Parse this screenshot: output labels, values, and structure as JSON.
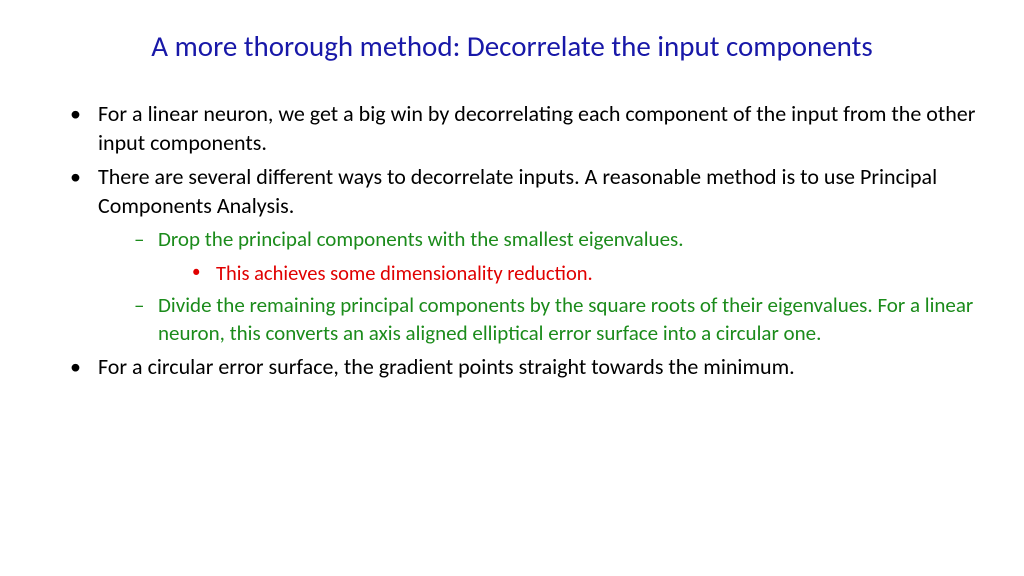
{
  "title": "A more thorough method: Decorrelate the input components",
  "bullets": {
    "b1": "For a linear  neuron, we get a big win by decorrelating each component of the input from the other input components.",
    "b2": "There are several different ways to decorrelate inputs. A reasonable method is to use Principal Components Analysis.",
    "b2_1": "Drop the principal components with the smallest eigenvalues.",
    "b2_1_1": "This achieves some dimensionality reduction.",
    "b2_2": "Divide the remaining principal components by the square roots of their eigenvalues. For a linear neuron,  this  converts an axis aligned elliptical error surface into a circular one.",
    "b3": "For a circular error surface, the gradient points straight towards the minimum."
  },
  "colors": {
    "title": "#1818a8",
    "body": "#000000",
    "green": "#1b8b1b",
    "red": "#e00000"
  }
}
